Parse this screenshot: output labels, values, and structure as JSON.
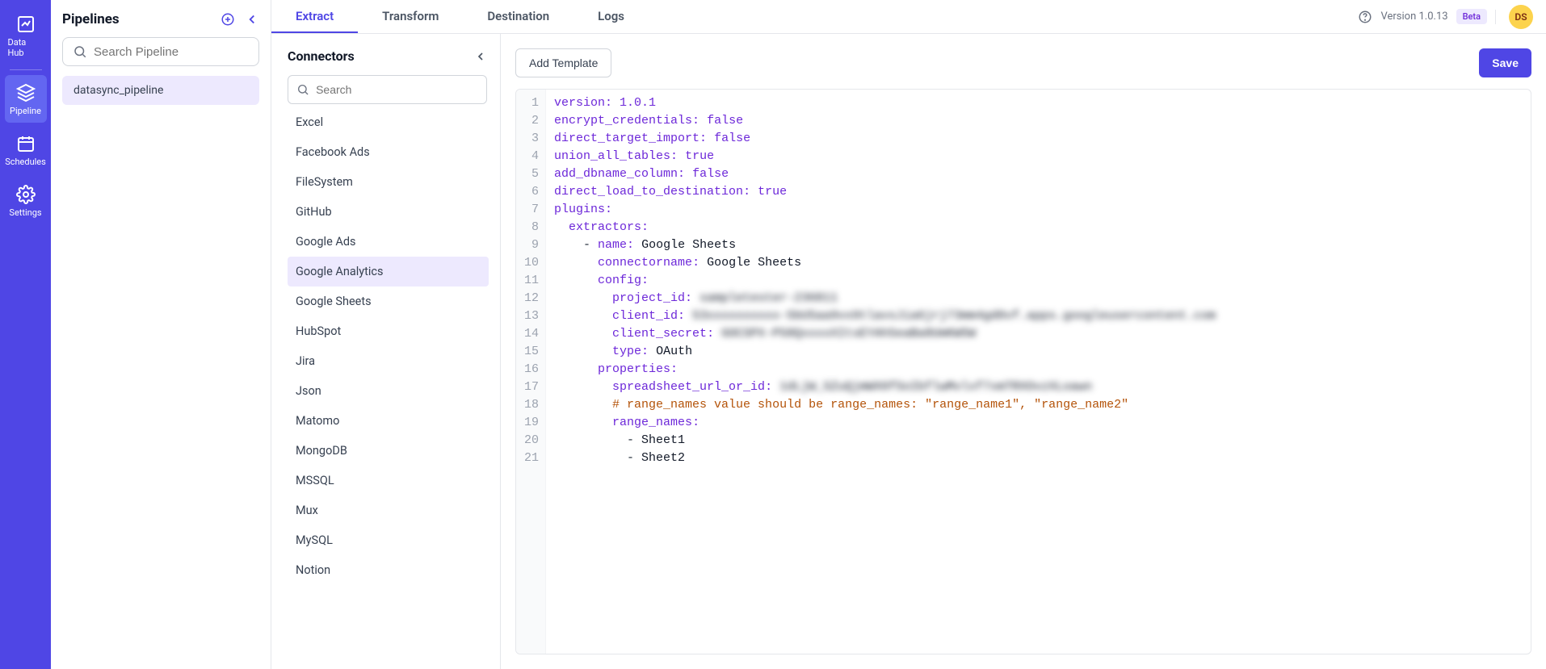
{
  "nav_rail": [
    {
      "id": "data-hub",
      "label": "Data Hub",
      "icon": "logo"
    },
    {
      "id": "pipeline",
      "label": "Pipeline",
      "icon": "layers",
      "active": true
    },
    {
      "id": "schedules",
      "label": "Schedules",
      "icon": "calendar"
    },
    {
      "id": "settings",
      "label": "Settings",
      "icon": "gear"
    }
  ],
  "pipelines": {
    "title": "Pipelines",
    "search_placeholder": "Search Pipeline",
    "items": [
      {
        "name": "datasync_pipeline",
        "active": true
      }
    ]
  },
  "tabs": [
    {
      "label": "Extract",
      "active": true
    },
    {
      "label": "Transform"
    },
    {
      "label": "Destination"
    },
    {
      "label": "Logs"
    }
  ],
  "top_bar": {
    "version": "Version 1.0.13",
    "beta": "Beta",
    "avatar": "DS"
  },
  "connectors": {
    "title": "Connectors",
    "search_placeholder": "Search",
    "items": [
      {
        "name": "Excel"
      },
      {
        "name": "Facebook Ads"
      },
      {
        "name": "FileSystem"
      },
      {
        "name": "GitHub"
      },
      {
        "name": "Google Ads"
      },
      {
        "name": "Google Analytics",
        "active": true
      },
      {
        "name": "Google Sheets"
      },
      {
        "name": "HubSpot"
      },
      {
        "name": "Jira"
      },
      {
        "name": "Json"
      },
      {
        "name": "Matomo"
      },
      {
        "name": "MongoDB"
      },
      {
        "name": "MSSQL"
      },
      {
        "name": "Mux"
      },
      {
        "name": "MySQL"
      },
      {
        "name": "Notion"
      }
    ]
  },
  "editor": {
    "add_template": "Add Template",
    "save": "Save",
    "lines": [
      {
        "n": 1,
        "segs": [
          {
            "t": "key",
            "v": "version"
          },
          {
            "t": "punct",
            "v": ": "
          },
          {
            "t": "num",
            "v": "1.0.1"
          }
        ]
      },
      {
        "n": 2,
        "segs": [
          {
            "t": "key",
            "v": "encrypt_credentials"
          },
          {
            "t": "punct",
            "v": ": "
          },
          {
            "t": "bool",
            "v": "false"
          }
        ]
      },
      {
        "n": 3,
        "segs": [
          {
            "t": "key",
            "v": "direct_target_import"
          },
          {
            "t": "punct",
            "v": ": "
          },
          {
            "t": "bool",
            "v": "false"
          }
        ]
      },
      {
        "n": 4,
        "segs": [
          {
            "t": "key",
            "v": "union_all_tables"
          },
          {
            "t": "punct",
            "v": ": "
          },
          {
            "t": "bool",
            "v": "true"
          }
        ]
      },
      {
        "n": 5,
        "segs": [
          {
            "t": "key",
            "v": "add_dbname_column"
          },
          {
            "t": "punct",
            "v": ": "
          },
          {
            "t": "bool",
            "v": "false"
          }
        ]
      },
      {
        "n": 6,
        "segs": [
          {
            "t": "key",
            "v": "direct_load_to_destination"
          },
          {
            "t": "punct",
            "v": ": "
          },
          {
            "t": "bool",
            "v": "true"
          }
        ]
      },
      {
        "n": 7,
        "segs": [
          {
            "t": "key",
            "v": "plugins"
          },
          {
            "t": "punct",
            "v": ":"
          }
        ]
      },
      {
        "n": 8,
        "segs": [
          {
            "t": "indent",
            "v": "  "
          },
          {
            "t": "key",
            "v": "extractors"
          },
          {
            "t": "punct",
            "v": ":"
          }
        ]
      },
      {
        "n": 9,
        "segs": [
          {
            "t": "indent",
            "v": "    - "
          },
          {
            "t": "key",
            "v": "name"
          },
          {
            "t": "punct",
            "v": ": "
          },
          {
            "t": "val",
            "v": "Google Sheets"
          }
        ]
      },
      {
        "n": 10,
        "segs": [
          {
            "t": "indent",
            "v": "      "
          },
          {
            "t": "key",
            "v": "connectorname"
          },
          {
            "t": "punct",
            "v": ": "
          },
          {
            "t": "val",
            "v": "Google Sheets"
          }
        ]
      },
      {
        "n": 11,
        "segs": [
          {
            "t": "indent",
            "v": "      "
          },
          {
            "t": "key",
            "v": "config"
          },
          {
            "t": "punct",
            "v": ":"
          }
        ]
      },
      {
        "n": 12,
        "segs": [
          {
            "t": "indent",
            "v": "        "
          },
          {
            "t": "key",
            "v": "project_id"
          },
          {
            "t": "punct",
            "v": ": "
          },
          {
            "t": "blur",
            "v": "sampletester-236811"
          }
        ]
      },
      {
        "n": 13,
        "segs": [
          {
            "t": "indent",
            "v": "        "
          },
          {
            "t": "key",
            "v": "client_id"
          },
          {
            "t": "punct",
            "v": ": "
          },
          {
            "t": "blur",
            "v": "53xxxxxxxxxx-5bU5aa9vx9tlavsJia6jrj73mm4gd0vf.apps.googleusercontent.com"
          }
        ]
      },
      {
        "n": 14,
        "segs": [
          {
            "t": "indent",
            "v": "        "
          },
          {
            "t": "key",
            "v": "client_secret"
          },
          {
            "t": "punct",
            "v": ": "
          },
          {
            "t": "blur",
            "v": "GOCSPX-P58QxxxxXItsEYAh5eaBa8UmKW5W"
          }
        ]
      },
      {
        "n": 15,
        "segs": [
          {
            "t": "indent",
            "v": "        "
          },
          {
            "t": "key",
            "v": "type"
          },
          {
            "t": "punct",
            "v": ": "
          },
          {
            "t": "val",
            "v": "OAuth"
          }
        ]
      },
      {
        "n": 16,
        "segs": [
          {
            "t": "indent",
            "v": "      "
          },
          {
            "t": "key",
            "v": "properties"
          },
          {
            "t": "punct",
            "v": ":"
          }
        ]
      },
      {
        "n": 17,
        "segs": [
          {
            "t": "indent",
            "v": "        "
          },
          {
            "t": "key",
            "v": "spreadsheet_url_or_id"
          },
          {
            "t": "punct",
            "v": ": "
          },
          {
            "t": "blur",
            "v": "1dLjW_SZuQjmWX0fSoIbflwMvlxf7xmTRXOvzXLoawn"
          }
        ]
      },
      {
        "n": 18,
        "segs": [
          {
            "t": "indent",
            "v": "        "
          },
          {
            "t": "comment",
            "v": "# range_names value should be range_names: \"range_name1\", \"range_name2\""
          }
        ]
      },
      {
        "n": 19,
        "segs": [
          {
            "t": "indent",
            "v": "        "
          },
          {
            "t": "key",
            "v": "range_names"
          },
          {
            "t": "punct",
            "v": ":"
          }
        ]
      },
      {
        "n": 20,
        "segs": [
          {
            "t": "indent",
            "v": "          - "
          },
          {
            "t": "val",
            "v": "Sheet1"
          }
        ]
      },
      {
        "n": 21,
        "segs": [
          {
            "t": "indent",
            "v": "          - "
          },
          {
            "t": "val",
            "v": "Sheet2"
          }
        ]
      }
    ]
  }
}
